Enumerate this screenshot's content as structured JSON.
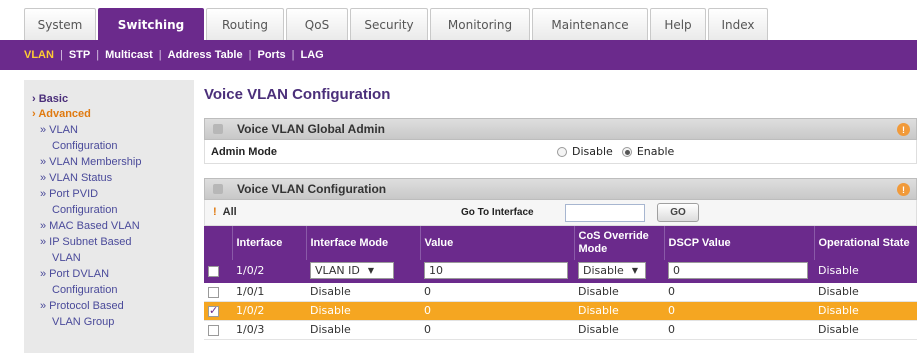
{
  "tabs": [
    {
      "label": "System",
      "active": false
    },
    {
      "label": "Switching",
      "active": true
    },
    {
      "label": "Routing",
      "active": false
    },
    {
      "label": "QoS",
      "active": false
    },
    {
      "label": "Security",
      "active": false
    },
    {
      "label": "Monitoring",
      "active": false
    },
    {
      "label": "Maintenance",
      "active": false
    },
    {
      "label": "Help",
      "active": false
    },
    {
      "label": "Index",
      "active": false
    }
  ],
  "subnav": [
    {
      "label": "VLAN",
      "active": true
    },
    {
      "label": "STP",
      "active": false
    },
    {
      "label": "Multicast",
      "active": false
    },
    {
      "label": "Address Table",
      "active": false
    },
    {
      "label": "Ports",
      "active": false
    },
    {
      "label": "LAG",
      "active": false
    }
  ],
  "sidebar": {
    "basic": "Basic",
    "advanced": "Advanced",
    "items": [
      {
        "line1": "» VLAN",
        "line2": "Configuration"
      },
      {
        "line1": "» VLAN Membership",
        "line2": ""
      },
      {
        "line1": "» VLAN Status",
        "line2": ""
      },
      {
        "line1": "» Port PVID",
        "line2": "Configuration"
      },
      {
        "line1": "» MAC Based VLAN",
        "line2": ""
      },
      {
        "line1": "» IP Subnet Based",
        "line2": "VLAN"
      },
      {
        "line1": "» Port DVLAN",
        "line2": "Configuration"
      },
      {
        "line1": "» Protocol Based",
        "line2": "VLAN Group"
      }
    ]
  },
  "page_title": "Voice VLAN Configuration",
  "global_admin": {
    "title": "Voice VLAN Global Admin",
    "admin_label": "Admin Mode",
    "disable_label": "Disable",
    "enable_label": "Enable",
    "selected": "Enable"
  },
  "config": {
    "title": "Voice VLAN Configuration",
    "all_mark": "!",
    "all_label": "All",
    "goto_label": "Go To Interface",
    "goto_value": "",
    "go_button": "GO",
    "headers": [
      "Interface",
      "Interface Mode",
      "Value",
      "CoS Override Mode",
      "DSCP Value",
      "Operational State"
    ],
    "edit_row": {
      "interface": "1/0/2",
      "mode": "VLAN ID",
      "value": "10",
      "cos": "Disable",
      "dscp": "0",
      "state": "Disable"
    },
    "rows": [
      {
        "interface": "1/0/1",
        "mode": "Disable",
        "value": "0",
        "cos": "Disable",
        "dscp": "0",
        "state": "Disable",
        "checked": false
      },
      {
        "interface": "1/0/2",
        "mode": "Disable",
        "value": "0",
        "cos": "Disable",
        "dscp": "0",
        "state": "Disable",
        "checked": true
      },
      {
        "interface": "1/0/3",
        "mode": "Disable",
        "value": "0",
        "cos": "Disable",
        "dscp": "0",
        "state": "Disable",
        "checked": false
      }
    ]
  },
  "help_icon": "!",
  "colors": {
    "brand_purple": "#6b2a8c",
    "selected_row": "#f5a621",
    "accent_orange": "#e07a10"
  }
}
